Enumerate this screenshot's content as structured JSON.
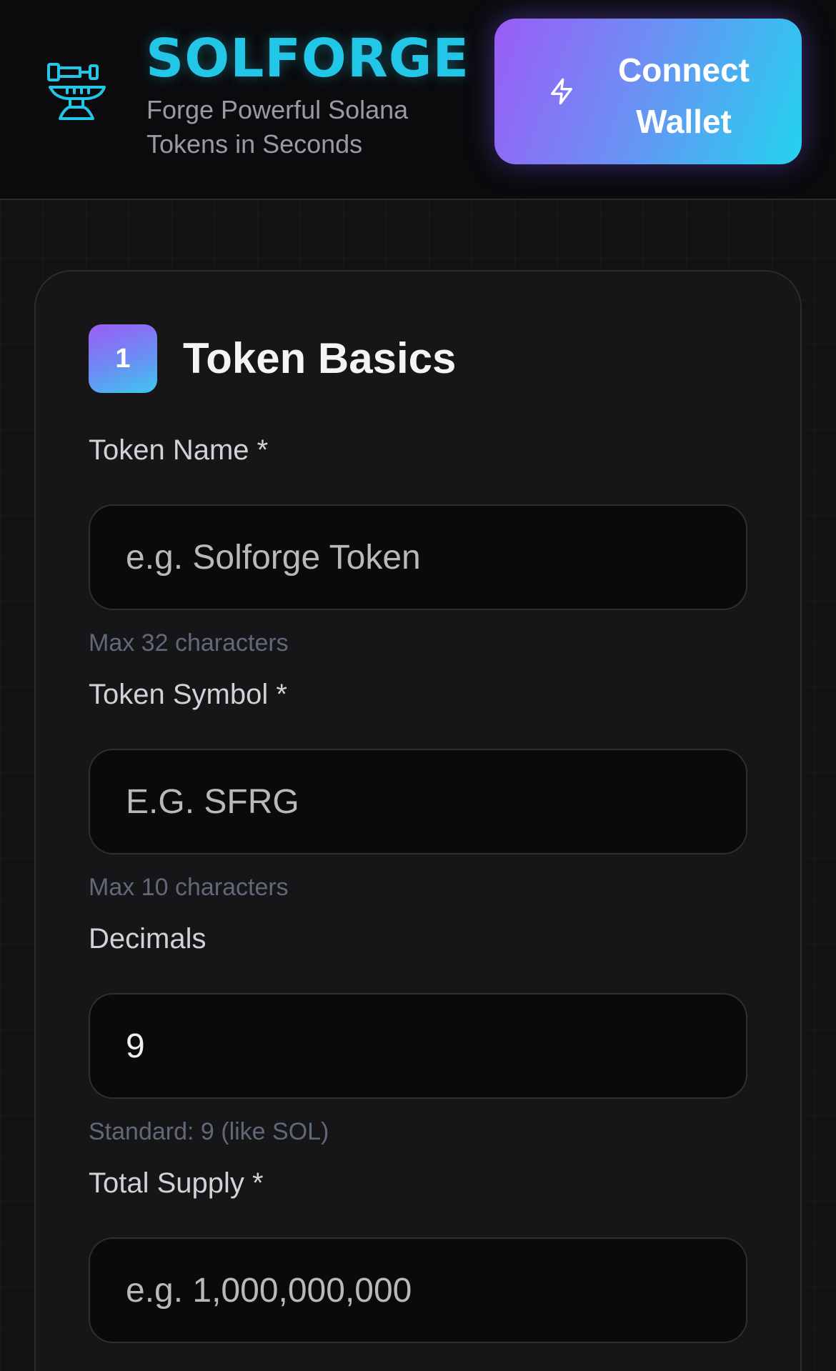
{
  "header": {
    "brand_title": "SOLFORGE",
    "brand_subtitle": "Forge Powerful Solana Tokens in Seconds",
    "logo_icon": "anvil-hammer-icon",
    "connect_button": {
      "label": "Connect Wallet",
      "icon": "lightning-bolt-icon"
    }
  },
  "colors": {
    "brand_cyan": "#22c6e6",
    "gradient_purple": "#9b5cf6",
    "gradient_cyan": "#22d3ee",
    "hint_text": "#5f6978"
  },
  "form": {
    "step_number": "1",
    "section_title": "Token Basics",
    "fields": [
      {
        "label": "Token Name *",
        "value": "",
        "placeholder": "e.g. Solforge Token",
        "hint": "Max 32 characters"
      },
      {
        "label": "Token Symbol *",
        "value": "",
        "placeholder": "E.G. SFRG",
        "hint": "Max 10 characters"
      },
      {
        "label": "Decimals",
        "value": "9",
        "placeholder": "",
        "hint": "Standard: 9 (like SOL)"
      },
      {
        "label": "Total Supply *",
        "value": "",
        "placeholder": "e.g. 1,000,000,000",
        "hint": ""
      }
    ]
  }
}
